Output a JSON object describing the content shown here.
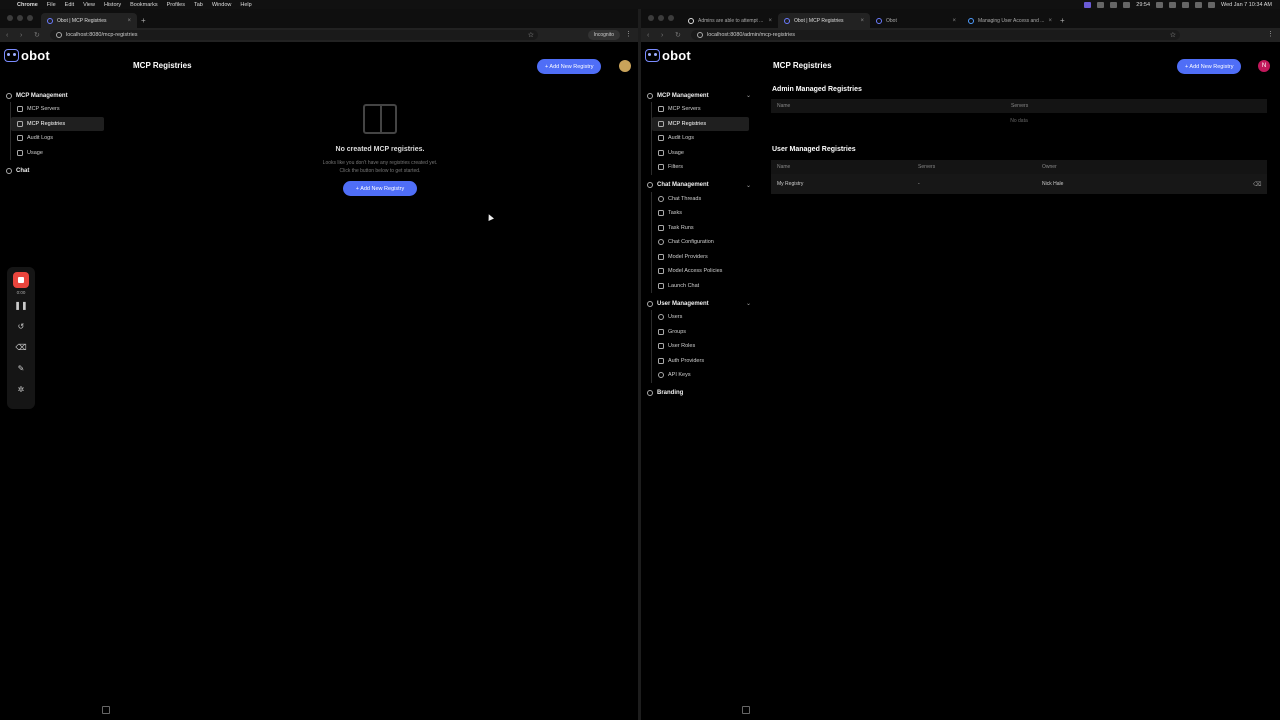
{
  "menubar": {
    "app": "Chrome",
    "menus": [
      "File",
      "Edit",
      "View",
      "History",
      "Bookmarks",
      "Profiles",
      "Tab",
      "Window",
      "Help"
    ],
    "time_short": "29:54",
    "clock": "Wed Jan 7  10:34 AM"
  },
  "left": {
    "tab_title": "Obot | MCP Registries",
    "url": "localhost:8080/mcp-registries",
    "incognito": "Incognito",
    "brand": "obot",
    "page_title": "MCP Registries",
    "add_button": "+ Add New Registry",
    "nav": {
      "section": "MCP Management",
      "items": [
        "MCP Servers",
        "MCP Registries",
        "Audit Logs",
        "Usage"
      ],
      "chat": "Chat"
    },
    "empty": {
      "heading": "No created MCP registries.",
      "line1": "Looks like you don't have any registries created yet.",
      "line2": "Click the button below to get started.",
      "button": "+ Add New Registry"
    },
    "recorder": {
      "time": "0:00"
    }
  },
  "right": {
    "tabs": [
      "Admins are able to attempt ...",
      "Obot | MCP Registries",
      "Obot",
      "Managing User Access and ..."
    ],
    "url": "localhost:8080/admin/mcp-registries",
    "brand": "obot",
    "page_title": "MCP Registries",
    "add_button": "+ Add New Registry",
    "avatar_letter": "N",
    "nav": {
      "mcp_section": "MCP Management",
      "mcp_items": [
        "MCP Servers",
        "MCP Registries",
        "Audit Logs",
        "Usage",
        "Filters"
      ],
      "chat_section": "Chat Management",
      "chat_items": [
        "Chat Threads",
        "Tasks",
        "Task Runs",
        "Chat Configuration",
        "Model Providers",
        "Model Access Policies",
        "Launch Chat"
      ],
      "user_section": "User Management",
      "user_items": [
        "Users",
        "Groups",
        "User Roles",
        "Auth Providers",
        "API Keys"
      ],
      "branding": "Branding"
    },
    "admin_heading": "Admin Managed Registries",
    "admin_cols": [
      "Name",
      "Servers"
    ],
    "no_data": "No data",
    "user_heading": "User Managed Registries",
    "user_cols": [
      "Name",
      "Servers",
      "Owner"
    ],
    "user_rows": [
      {
        "name": "My Registry",
        "servers": "-",
        "owner": "Nick Hale"
      }
    ]
  }
}
